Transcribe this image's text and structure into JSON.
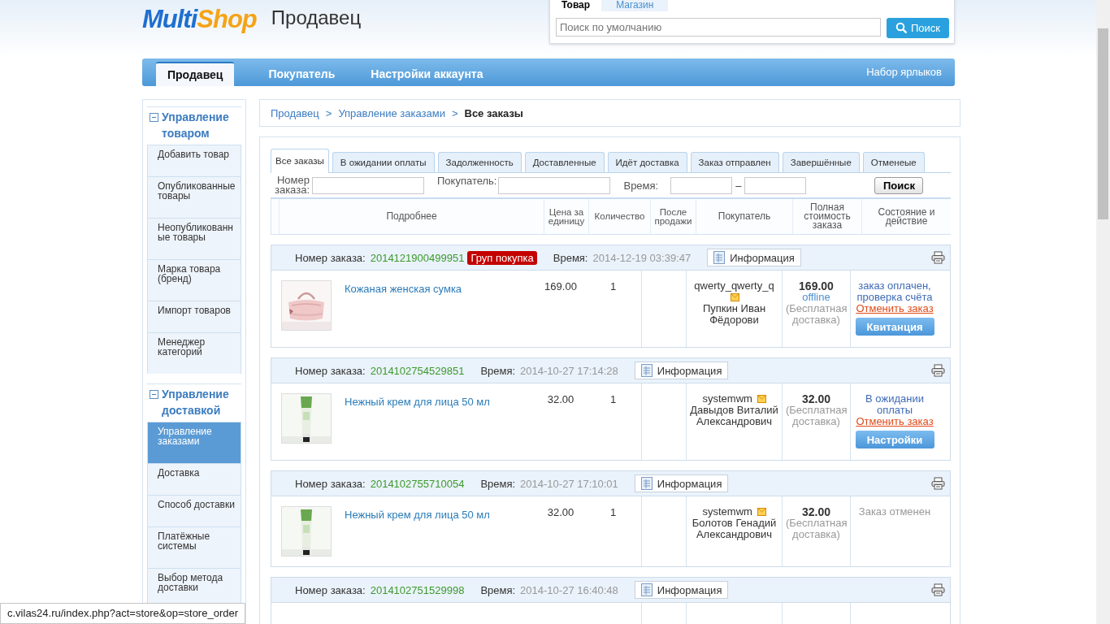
{
  "header": {
    "logo": {
      "first": "Multi",
      "second": "Shop"
    },
    "title": "Продавец"
  },
  "search": {
    "tabs": [
      {
        "label": "Товар",
        "selected": true
      },
      {
        "label": "Магазин",
        "selected": false
      }
    ],
    "placeholder": "Поиск по умолчанию",
    "button": "Поиск"
  },
  "nav": {
    "tabs": [
      {
        "label": "Продавец",
        "selected": true
      },
      {
        "label": "Покупатель",
        "selected": false
      },
      {
        "label": "Настройки аккаунта",
        "selected": false
      }
    ],
    "shortcuts": "Набор ярлыков"
  },
  "sidebar": {
    "sections": [
      {
        "title": "Управление товаром",
        "expanded": true,
        "items": [
          {
            "label": "Добавить товар",
            "selected": false
          },
          {
            "label": "Опубликованные товары",
            "selected": false
          },
          {
            "label": "Неопубликованные товары",
            "selected": false
          },
          {
            "label": "Марка товара (бренд)",
            "selected": false
          },
          {
            "label": "Импорт товаров",
            "selected": false
          },
          {
            "label": "Менеджер категорий",
            "selected": false
          }
        ]
      },
      {
        "title": "Управление доставкой",
        "expanded": true,
        "items": [
          {
            "label": "Управление заказами",
            "selected": true
          },
          {
            "label": "Доставка",
            "selected": false
          },
          {
            "label": "Способ доставки",
            "selected": false
          },
          {
            "label": "Платёжные системы",
            "selected": false
          },
          {
            "label": "Выбор метода доставки",
            "selected": false
          }
        ]
      }
    ]
  },
  "breadcrumb": [
    {
      "label": "Продавец",
      "kind": "link"
    },
    {
      "label": ">",
      "kind": "separator"
    },
    {
      "label": "Управление заказами",
      "kind": "link"
    },
    {
      "label": ">",
      "kind": "separator"
    },
    {
      "label": "Все заказы",
      "kind": "current"
    }
  ],
  "order_tabs": [
    {
      "label": "Все заказы",
      "selected": true
    },
    {
      "label": "В ожидании оплаты",
      "selected": false
    },
    {
      "label": "Задолженность",
      "selected": false
    },
    {
      "label": "Доставленные",
      "selected": false
    },
    {
      "label": "Идёт доставка",
      "selected": false
    },
    {
      "label": "Заказ отправлен",
      "selected": false
    },
    {
      "label": "Завершённые",
      "selected": false
    },
    {
      "label": "Отменеые",
      "selected": false
    }
  ],
  "filters": {
    "order_number_label": "Номер заказа:",
    "buyer_label": "Покупатель:",
    "time_label": "Время:",
    "range_dash": "–",
    "button": "Поиск"
  },
  "columns": [
    "Подробнее",
    "Цена за единицу",
    "Количество",
    "После продажи",
    "Покупатель",
    "Полная стоимость заказа",
    "Состояние и действие"
  ],
  "orders": [
    {
      "number_label": "Номер заказа:",
      "number": "2014121900499951",
      "badge": "Груп покупка",
      "time_label": "Время:",
      "time": "2014-12-19 03:39:47",
      "info_button": "Информация",
      "item": {
        "name": "Кожаная женская сумка",
        "price": "169.00",
        "quantity": "1",
        "buyer_login": "qwerty_qwerty_q",
        "buyer_name": "Пупкин Иван Фёдорови",
        "total": "169.00",
        "payment": "offline",
        "delivery": "(Бесплатная доставка)",
        "status": {
          "text": "заказ оплачен, проверка счёта",
          "kind": "active"
        },
        "cancel_link": "Отменить заказ",
        "action_button": "Квитанция"
      }
    },
    {
      "number_label": "Номер заказа:",
      "number": "2014102754529851",
      "time_label": "Время:",
      "time": "2014-10-27 17:14:28",
      "info_button": "Информация",
      "item": {
        "name": "Нежный крем для лица 50 мл",
        "price": "32.00",
        "quantity": "1",
        "buyer_login": "systemwm",
        "buyer_name": "Давыдов Виталий Александрович",
        "total": "32.00",
        "delivery": "(Бесплатная доставка)",
        "status": {
          "text": "В ожидании оплаты",
          "kind": "active"
        },
        "cancel_link": "Отменить заказ",
        "action_button": "Настройки"
      }
    },
    {
      "number_label": "Номер заказа:",
      "number": "2014102755710054",
      "time_label": "Время:",
      "time": "2014-10-27 17:10:01",
      "info_button": "Информация",
      "item": {
        "name": "Нежный крем для лица 50 мл",
        "price": "32.00",
        "quantity": "1",
        "buyer_login": "systemwm",
        "buyer_name": "Болотов Генадий Александрович",
        "total": "32.00",
        "delivery": "(Бесплатная доставка)",
        "status": {
          "text": "Заказ отменен",
          "kind": "cancelled"
        }
      }
    },
    {
      "number_label": "Номер заказа:",
      "number": "2014102751529998",
      "time_label": "Время:",
      "time": "2014-10-27 16:40:48",
      "info_button": "Информация"
    }
  ],
  "status_bar": {
    "url": "c.vilas24.ru/index.php?act=store&op=store_order"
  }
}
